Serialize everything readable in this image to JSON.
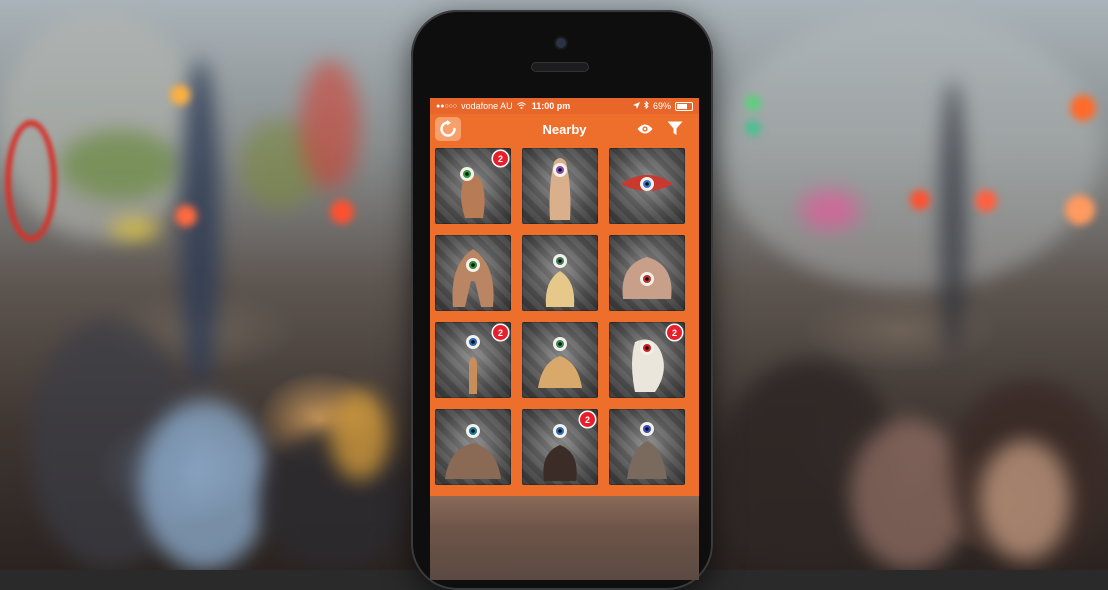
{
  "status_bar": {
    "signal": "●●○○○",
    "carrier": "vodafone AU",
    "wifi": "wifi-icon",
    "time": "11:00 pm",
    "location": "location-icon",
    "bluetooth": "bluetooth-icon",
    "battery_text": "69%",
    "battery_level": 0.69
  },
  "nav_bar": {
    "title": "Nearby",
    "refresh_icon": "refresh-icon",
    "eye_icon": "eye-icon",
    "filter_icon": "filter-icon"
  },
  "grid": {
    "items": [
      {
        "creature": "one-eyed finger creature",
        "badge": "2"
      },
      {
        "creature": "purple-eye pillar creature",
        "badge": ""
      },
      {
        "creature": "red lips eye creature",
        "badge": ""
      },
      {
        "creature": "green-eye legs creature",
        "badge": ""
      },
      {
        "creature": "mustache eye creature",
        "badge": ""
      },
      {
        "creature": "red-eye blob creature",
        "badge": ""
      },
      {
        "creature": "mouth stalk creature",
        "badge": "2"
      },
      {
        "creature": "yellow torso creature",
        "badge": ""
      },
      {
        "creature": "white worm eye creature",
        "badge": "2"
      },
      {
        "creature": "muscle torso creature",
        "badge": ""
      },
      {
        "creature": "dark body creature",
        "badge": "2"
      },
      {
        "creature": "grinning torso creature",
        "badge": ""
      }
    ]
  },
  "colors": {
    "accent": "#ee6f2c",
    "badge": "#e81f2a"
  }
}
